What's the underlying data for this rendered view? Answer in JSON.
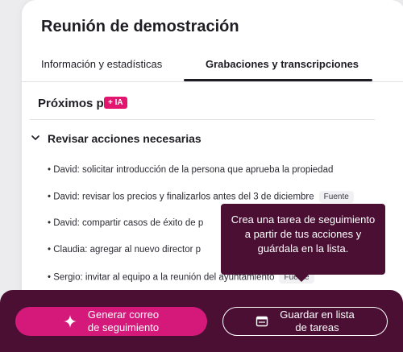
{
  "header": {
    "title": "Reunión de demostración"
  },
  "tabs": [
    {
      "label": "Información y estadísticas"
    },
    {
      "label": "Grabaciones y transcripciones"
    }
  ],
  "next_steps": {
    "title": "Próximos pa",
    "ai_badge": "+ IA",
    "group_title": "Revisar acciones necesarias",
    "items": [
      {
        "text": "• David: solicitar introducción de la persona que aprueba la propiedad"
      },
      {
        "text": "• David: revisar los precios y finalizarlos antes del 3 de diciembre",
        "source": "Fuente"
      },
      {
        "text": "• David: compartir casos de éxito de p"
      },
      {
        "text": "• Claudia: agregar al nuevo director p"
      },
      {
        "text": "• Sergio: invitar al equipo a la reunión del ayuntamiento",
        "source": "Fuente"
      }
    ]
  },
  "tooltip": {
    "text": "Crea una tarea de seguimiento a partir de tus acciones y guárdala en la lista."
  },
  "footer": {
    "primary_button": {
      "line1": "Generar correo",
      "line2": "de seguimiento",
      "icon": "sparkle-icon"
    },
    "secondary_button": {
      "line1": "Guardar en lista",
      "line2": "de tareas",
      "icon": "list-window-icon"
    }
  },
  "colors": {
    "accent": "#d4197a",
    "badge": "#e3166f",
    "dark_plum": "#4a0f33",
    "background": "#ecebee"
  }
}
